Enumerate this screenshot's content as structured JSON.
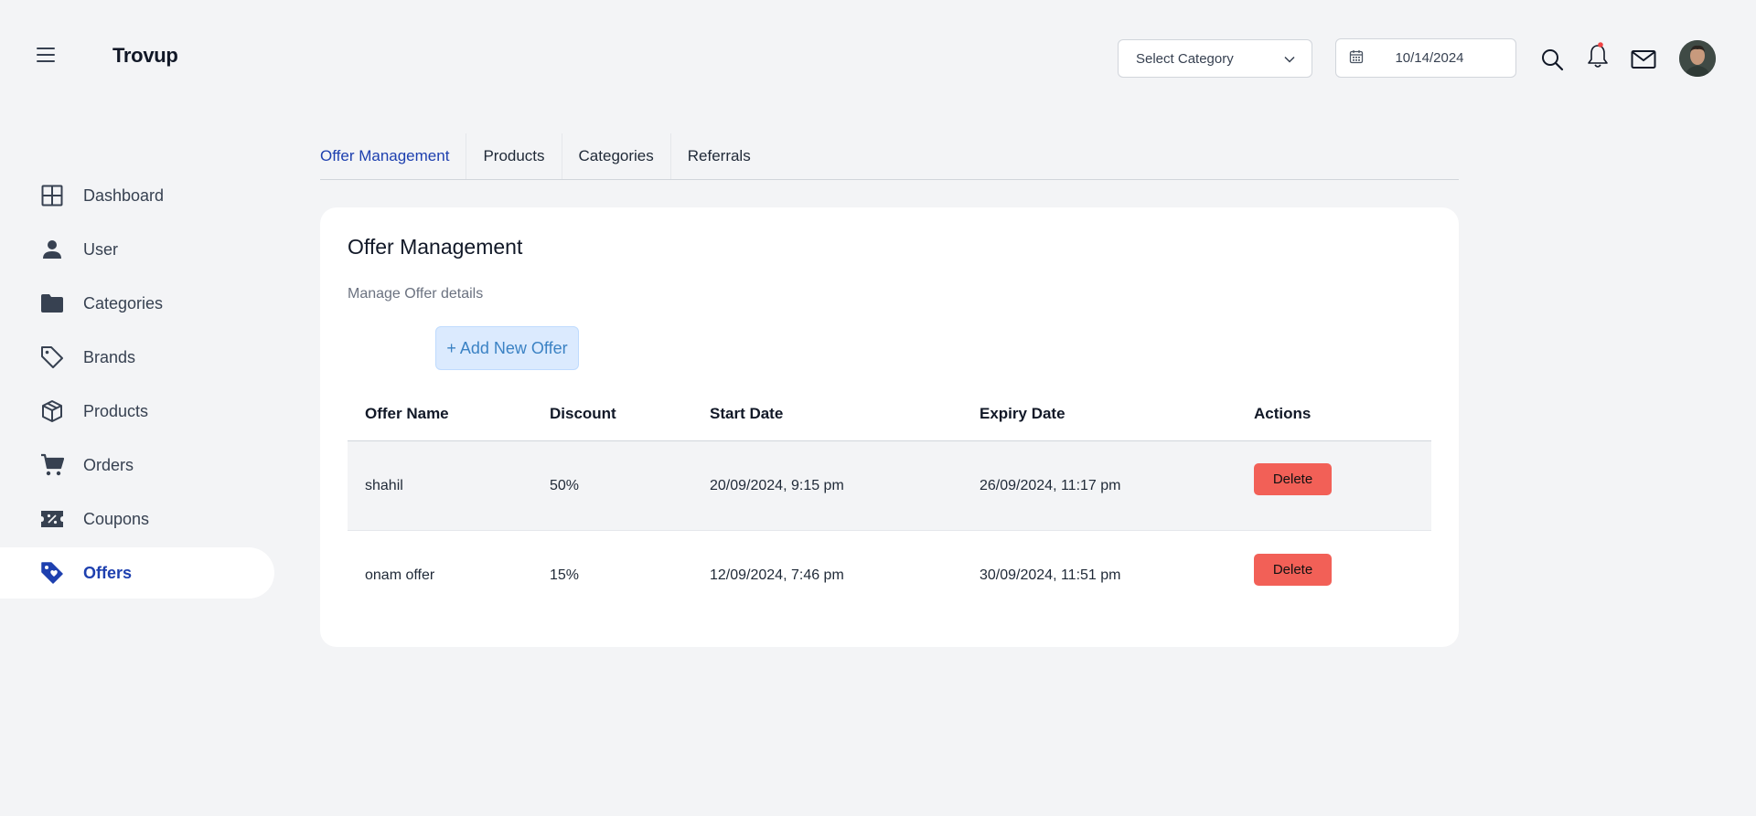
{
  "header": {
    "logo": "Trovup",
    "category_select": {
      "label": "Select Category"
    },
    "date": "10/14/2024",
    "icons": [
      "menu-icon",
      "calendar-icon",
      "chevron-down-icon",
      "search-icon",
      "bell-icon",
      "mail-icon"
    ],
    "notification_dot_color": "#ef4444"
  },
  "sidebar": {
    "items": [
      {
        "label": "Dashboard",
        "icon": "grid-icon",
        "active": false
      },
      {
        "label": "User",
        "icon": "user-icon",
        "active": false
      },
      {
        "label": "Categories",
        "icon": "folder-icon",
        "active": false
      },
      {
        "label": "Brands",
        "icon": "tag-icon",
        "active": false
      },
      {
        "label": "Products",
        "icon": "box-icon",
        "active": false
      },
      {
        "label": "Orders",
        "icon": "cart-icon",
        "active": false
      },
      {
        "label": "Coupons",
        "icon": "coupon-icon",
        "active": false
      },
      {
        "label": "Offers",
        "icon": "offer-tag-icon",
        "active": true
      }
    ]
  },
  "tabs": [
    {
      "label": "Offer Management",
      "active": true
    },
    {
      "label": "Products",
      "active": false
    },
    {
      "label": "Categories",
      "active": false
    },
    {
      "label": "Referrals",
      "active": false
    }
  ],
  "card": {
    "title": "Offer Management",
    "subtitle": "Manage Offer details",
    "add_button": "+ Add New Offer"
  },
  "table": {
    "columns": [
      "Offer Name",
      "Discount",
      "Start Date",
      "Expiry Date",
      "Actions"
    ],
    "rows": [
      {
        "name": "shahil",
        "discount": "50%",
        "start": "20/09/2024, 9:15 pm",
        "expiry": "26/09/2024, 11:17 pm",
        "action": "Delete"
      },
      {
        "name": "onam offer",
        "discount": "15%",
        "start": "12/09/2024, 7:46 pm",
        "expiry": "30/09/2024, 11:51 pm",
        "action": "Delete"
      }
    ]
  },
  "colors": {
    "accent": "#1e40af",
    "delete": "#f26057",
    "add_button_bg": "#dbeafe",
    "page_bg": "#f3f4f6"
  }
}
